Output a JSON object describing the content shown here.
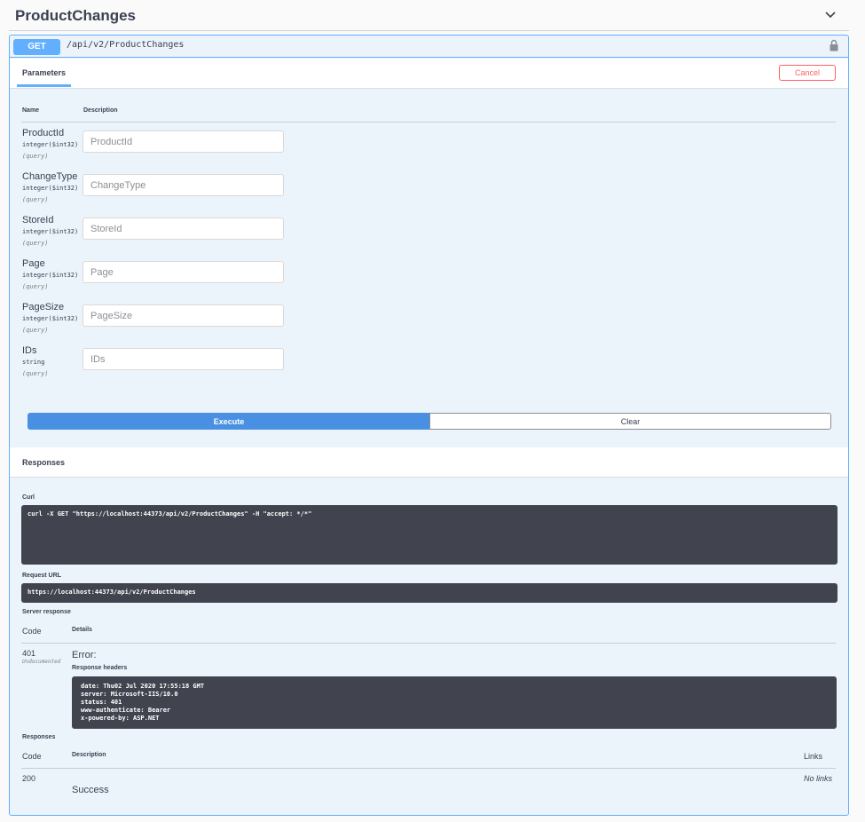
{
  "tag": {
    "title": "ProductChanges"
  },
  "op": {
    "method": "GET",
    "path": "/api/v2/ProductChanges"
  },
  "params_section": {
    "tab": "Parameters",
    "cancel": "Cancel",
    "col_name": "Name",
    "col_description": "Description"
  },
  "params": [
    {
      "name": "ProductId",
      "type": "integer($int32)",
      "in": "(query)",
      "placeholder": "ProductId"
    },
    {
      "name": "ChangeType",
      "type": "integer($int32)",
      "in": "(query)",
      "placeholder": "ChangeType"
    },
    {
      "name": "StoreId",
      "type": "integer($int32)",
      "in": "(query)",
      "placeholder": "StoreId"
    },
    {
      "name": "Page",
      "type": "integer($int32)",
      "in": "(query)",
      "placeholder": "Page"
    },
    {
      "name": "PageSize",
      "type": "integer($int32)",
      "in": "(query)",
      "placeholder": "PageSize"
    },
    {
      "name": "IDs",
      "type": "string",
      "in": "(query)",
      "placeholder": "IDs"
    }
  ],
  "actions": {
    "execute": "Execute",
    "clear": "Clear"
  },
  "responses_section": {
    "title": "Responses",
    "curl_label": "Curl",
    "curl": "curl -X GET \"https://localhost:44373/api/v2/ProductChanges\" -H \"accept: */*\"",
    "request_url_label": "Request URL",
    "request_url": "https://localhost:44373/api/v2/ProductChanges",
    "server_response_label": "Server response",
    "col_code": "Code",
    "col_details": "Details",
    "server_code": "401",
    "server_undocumented": "Undocumented",
    "error_text": "Error:",
    "response_headers_label": "Response headers",
    "response_headers": "date: Thu02 Jul 2020 17:55:18 GMT\nserver: Microsoft-IIS/10.0\nstatus: 401\nwww-authenticate: Bearer\nx-powered-by: ASP.NET",
    "responses_label": "Responses",
    "col_description": "Description",
    "col_links": "Links",
    "doc_code": "200",
    "doc_description": "Success",
    "doc_links": "No links"
  }
}
